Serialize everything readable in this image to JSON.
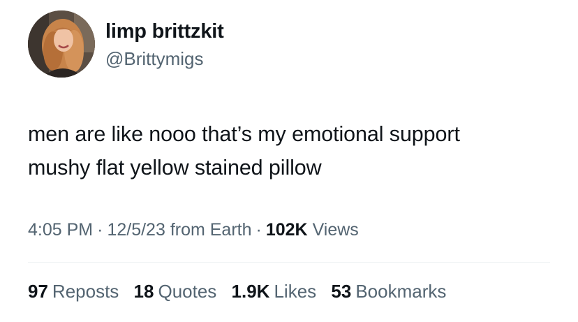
{
  "author": {
    "display_name": "limp brittzkit",
    "handle": "@Brittymigs",
    "avatar_icon": "profile-photo"
  },
  "tweet": {
    "text_lines": [
      "men are like nooo that’s my emotional support",
      "mushy flat yellow stained pillow"
    ],
    "time": "4:05 PM",
    "separator": "·",
    "date": "12/5/23",
    "source": "from Earth",
    "views_count": "102K",
    "views_label": "Views"
  },
  "stats": {
    "reposts": {
      "count": "97",
      "label": "Reposts"
    },
    "quotes": {
      "count": "18",
      "label": "Quotes"
    },
    "likes": {
      "count": "1.9K",
      "label": "Likes"
    },
    "bookmarks": {
      "count": "53",
      "label": "Bookmarks"
    }
  },
  "colors": {
    "text_primary": "#0f1419",
    "text_secondary": "#536471",
    "divider": "#eff3f4",
    "background": "#ffffff"
  }
}
